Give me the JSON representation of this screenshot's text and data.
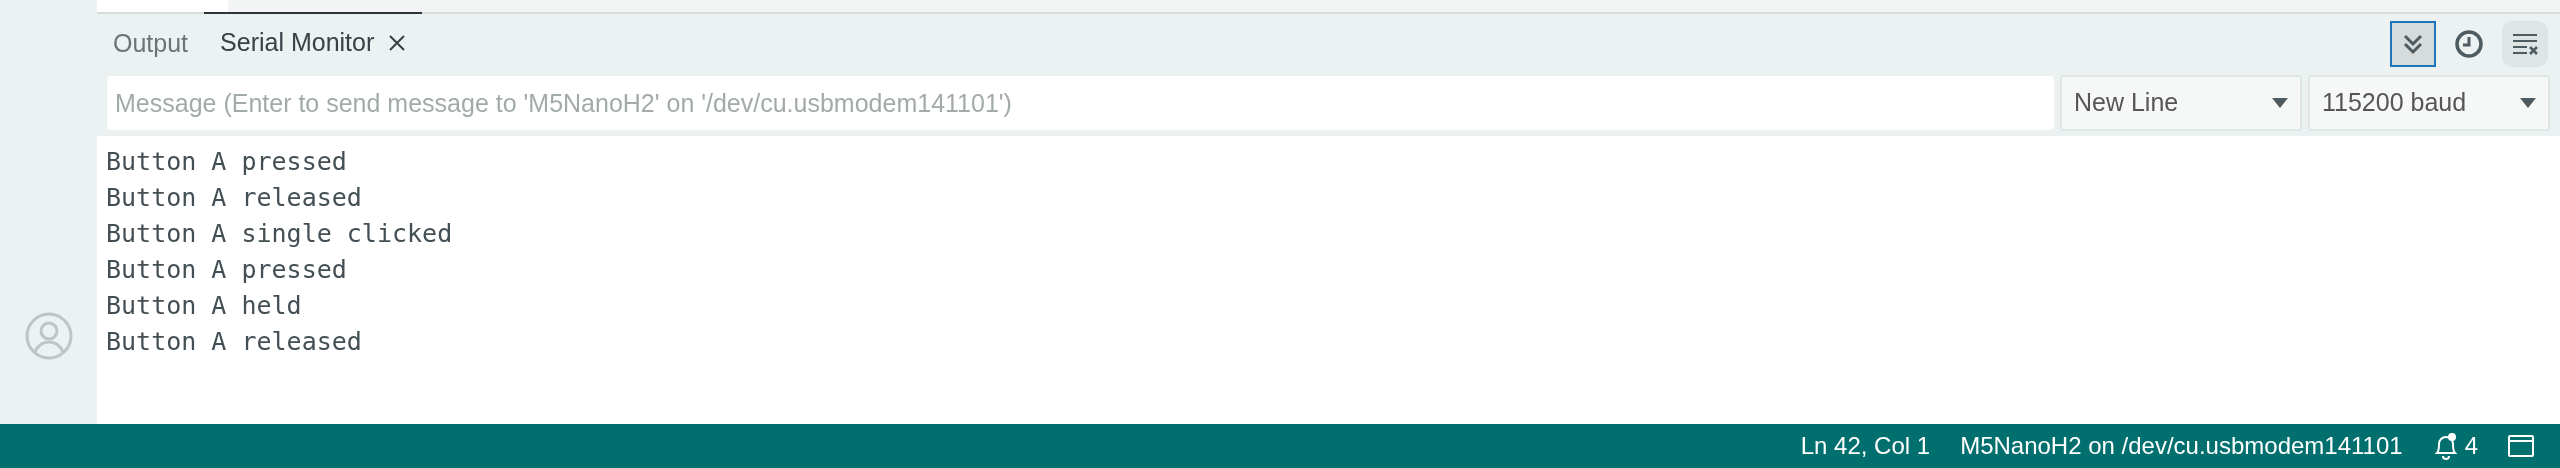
{
  "panel_tabs": [
    {
      "label": "Output",
      "selected": false,
      "closable": false
    },
    {
      "label": "Serial Monitor",
      "selected": true,
      "closable": true
    }
  ],
  "toolbar": [
    {
      "kind": "autoscroll",
      "on": true
    },
    {
      "kind": "timestamp",
      "on": false
    },
    {
      "kind": "clear",
      "on": false
    }
  ],
  "message_field": {
    "placeholder": "Message (Enter to send message to 'M5NanoH2' on '/dev/cu.usbmodem141101')"
  },
  "line_ending": {
    "value": "New Line"
  },
  "baud_rate": {
    "value": "115200 baud"
  },
  "serial_output": [
    "Button A pressed",
    "Button A released",
    "Button A single clicked",
    "Button A pressed",
    "Button A held",
    "Button A released"
  ],
  "status_bar": {
    "cursor": "Ln 42, Col 1",
    "board": "M5NanoH2 on /dev/cu.usbmodem141101",
    "notifications": "4"
  }
}
